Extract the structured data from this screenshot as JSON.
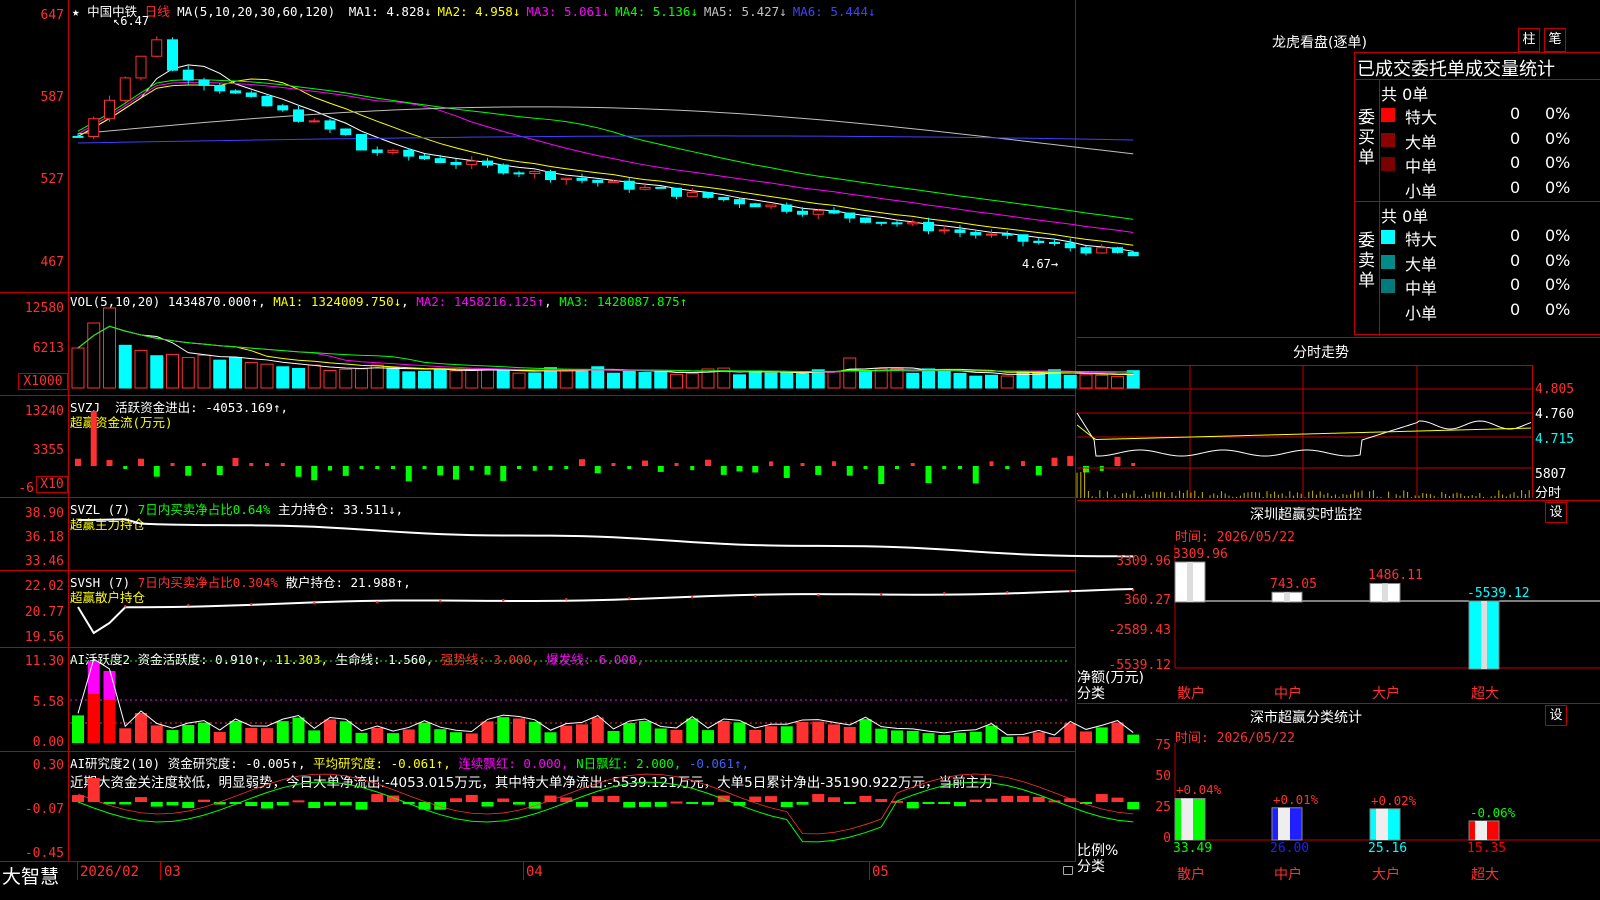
{
  "main": {
    "stock_name": "中国中铁",
    "period": "日线",
    "ma_header": "MA(5,10,20,30,60,120)",
    "ma_values": [
      {
        "label": "MA1:",
        "value": "4.828↓",
        "color": "#ffffff"
      },
      {
        "label": "MA2:",
        "value": "4.958↓",
        "color": "#ffff00"
      },
      {
        "label": "MA3:",
        "value": "5.061↓",
        "color": "#ff00ff"
      },
      {
        "label": "MA4:",
        "value": "5.136↓",
        "color": "#00ff00"
      },
      {
        "label": "MA5:",
        "value": "5.427↓",
        "color": "#c0c0c0"
      },
      {
        "label": "MA6:",
        "value": "5.444↓",
        "color": "#4040ff"
      }
    ],
    "y_ticks": [
      "647",
      "587",
      "527",
      "467"
    ],
    "high_marker": "6.47",
    "low_marker": "4.67"
  },
  "vol": {
    "header": "VOL(5,10,20)",
    "value": "1434870.000↑",
    "ma1": "MA1: 1324009.750↓",
    "ma2": "MA2: 1458216.125↑",
    "ma3": "MA3: 1428087.875↑",
    "y_ticks": [
      "12580",
      "6213"
    ],
    "unit": "X1000"
  },
  "svzj": {
    "header": "SVZJ",
    "label": "活跃资金进出: -4053.169↑,",
    "title": "超赢资金流(万元)",
    "y_ticks": [
      "13240",
      "3355",
      "-6"
    ],
    "unit": "X10"
  },
  "svzl": {
    "header": "SVZL (7)",
    "ratio": "7日内买卖净占比0.64%",
    "hold": "主力持仓: 33.511↓,",
    "title": "超赢主力持仓",
    "y_ticks": [
      "38.90",
      "36.18",
      "33.46"
    ]
  },
  "svsh": {
    "header": "SVSH (7)",
    "ratio": "7日内买卖净占比0.304%",
    "hold": "散户持仓: 21.988↑,",
    "title": "超赢散户持仓",
    "y_ticks": [
      "22.02",
      "20.77",
      "19.56"
    ]
  },
  "ai1": {
    "header": "AI活跃度2",
    "a": "资金活跃度: 0.910↑,",
    "b": "11.303,",
    "c": "生命线: 1.560,",
    "d": "强势线: 3.000,",
    "e": "爆发线: 6.000,",
    "y_ticks": [
      "11.30",
      "5.58",
      "0.00"
    ]
  },
  "ai2": {
    "header": "AI研究度2(10)",
    "a": "资金研究度: -0.005↑,",
    "b": "平均研究度: -0.061↑,",
    "c": "连续飘红: 0.000,",
    "d": "N日飘红: 2.000,",
    "e": "-0.061↑,",
    "note": "近期大资金关注度较低，明显弱势，今日大单净流出:-4053.015万元，其中特大单净流出:-5539.121万元，大单5日累计净出-35190.922万元，当前主力",
    "y_ticks": [
      "0.30",
      "-0.07",
      "-0.45"
    ]
  },
  "bottom": {
    "brand": "大智慧",
    "dates": [
      "2026/02",
      "03",
      "04",
      "05"
    ]
  },
  "right": {
    "lhkp_title": "龙虎看盘(逐单)",
    "btn_zhu": "柱",
    "btn_bi": "笔",
    "stat_title": "已成交委托单成交量统计",
    "buy_side": "委买单",
    "sell_side": "委卖单",
    "buy_total": "共 0单",
    "sell_total": "共 0单",
    "buy_rows": [
      {
        "name": "特大",
        "count": "0",
        "pct": "0%",
        "color": "#ff0000"
      },
      {
        "name": "大单",
        "count": "0",
        "pct": "0%",
        "color": "#8b0000"
      },
      {
        "name": "中单",
        "count": "0",
        "pct": "0%",
        "color": "#7a0000"
      },
      {
        "name": "小单",
        "count": "0",
        "pct": "0%",
        "color": "#000000"
      }
    ],
    "sell_rows": [
      {
        "name": "特大",
        "count": "0",
        "pct": "0%",
        "color": "#00ffff"
      },
      {
        "name": "大单",
        "count": "0",
        "pct": "0%",
        "color": "#008b8b"
      },
      {
        "name": "中单",
        "count": "0",
        "pct": "0%",
        "color": "#007a7a"
      },
      {
        "name": "小单",
        "count": "0",
        "pct": "0%",
        "color": "#000000"
      }
    ],
    "fs_title": "分时走势",
    "fs_prices": [
      "4.805",
      "4.760",
      "4.715"
    ],
    "fs_vol": "5807",
    "fs_vol2": "分时",
    "sz_title": "深圳超赢实时监控",
    "sz_set": "设",
    "sz_time": "时间: 2026/05/22",
    "sz_y": [
      "3309.96",
      "360.27",
      "-2589.43",
      "-5539.12"
    ],
    "sz_y_label": "净额(万元)",
    "sz_x_label": "分类",
    "sz_cats": [
      "散户",
      "中户",
      "大户",
      "超大"
    ],
    "sz_vals": [
      "3309.96",
      "743.05",
      "1486.11",
      "-5539.12"
    ],
    "sz_nums": [
      3309.96,
      743.05,
      1486.11,
      -5539.12
    ],
    "fl_title": "深市超赢分类统计",
    "fl_set": "设",
    "fl_time": "时间: 2026/05/22",
    "fl_y": [
      "75",
      "50",
      "25",
      "0"
    ],
    "fl_y_label": "比例%",
    "fl_x_label": "分类",
    "fl_cats": [
      "散户",
      "中户",
      "大户",
      "超大"
    ],
    "fl_pcts": [
      "+0.04%",
      "+0.01%",
      "+0.02%",
      "-0.06%"
    ],
    "fl_vals": [
      "33.49",
      "26.00",
      "25.16",
      "15.35"
    ],
    "fl_nums": [
      33.49,
      26.0,
      25.16,
      15.35
    ]
  }
}
